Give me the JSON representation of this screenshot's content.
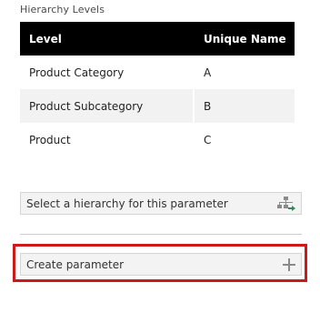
{
  "hierarchy_levels": {
    "title": "Hierarchy Levels",
    "columns": {
      "level": "Level",
      "unique_name": "Unique Name"
    },
    "rows": [
      {
        "level": "Product Category",
        "unique_name": "A"
      },
      {
        "level": "Product Subcategory",
        "unique_name": "B"
      },
      {
        "level": "Product",
        "unique_name": "C"
      }
    ]
  },
  "hierarchy_select": {
    "placeholder": "Select a hierarchy for this parameter",
    "icon": "hierarchy-icon",
    "icon_accent": "#2e8b57"
  },
  "create_parameter": {
    "label": "Create parameter",
    "icon": "plus-icon",
    "highlight_color": "#cc1a1a"
  }
}
